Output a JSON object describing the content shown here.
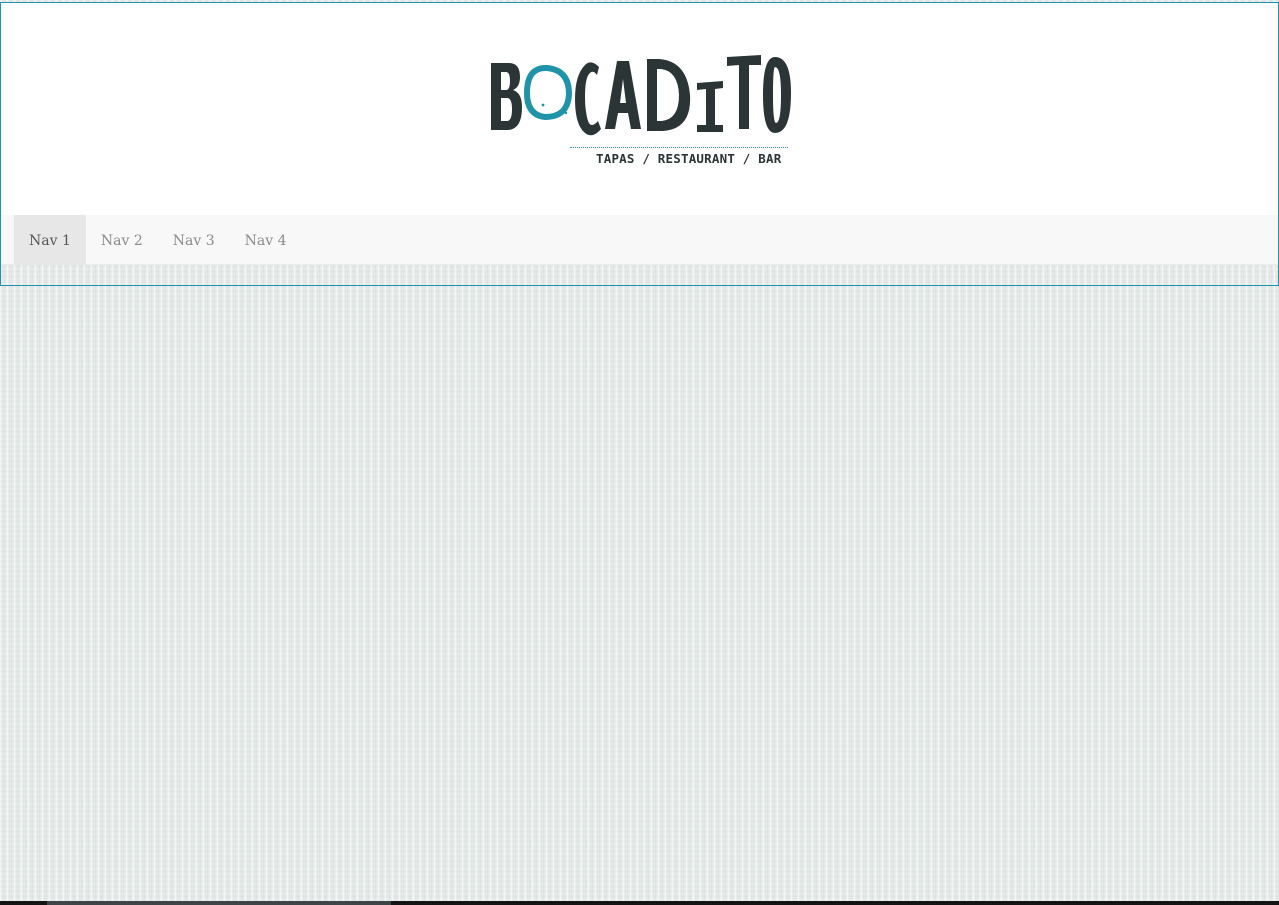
{
  "brand": {
    "name": "BOCADITO",
    "tagline": "TAPAS / RESTAURANT / BAR",
    "primary_color": "#2c3536",
    "accent_color": "#1f93a8"
  },
  "nav": {
    "items": [
      {
        "label": "Nav 1",
        "active": true
      },
      {
        "label": "Nav 2",
        "active": false
      },
      {
        "label": "Nav 3",
        "active": false
      },
      {
        "label": "Nav 4",
        "active": false
      }
    ]
  }
}
